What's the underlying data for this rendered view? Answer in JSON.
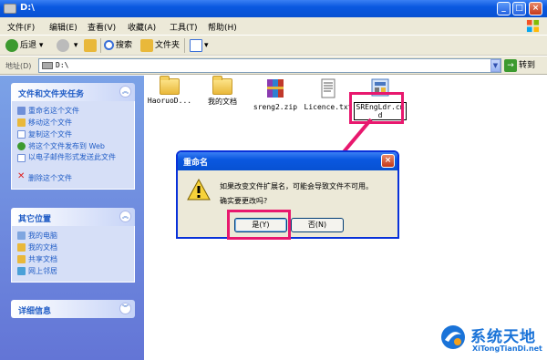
{
  "window": {
    "title": "D:\\"
  },
  "menu": [
    "文件(F)",
    "编辑(E)",
    "查看(V)",
    "收藏(A)",
    "工具(T)",
    "帮助(H)"
  ],
  "toolbar": {
    "back": "后退",
    "search": "搜索",
    "folders": "文件夹"
  },
  "address": {
    "label": "地址(D)",
    "value": "D:\\",
    "go": "转到"
  },
  "tasks_panel": {
    "title": "文件和文件夹任务",
    "items": [
      "重命名这个文件",
      "移动这个文件",
      "复制这个文件",
      "将这个文件发布到 Web",
      "以电子邮件形式发送此文件",
      "删除这个文件"
    ]
  },
  "places_panel": {
    "title": "其它位置",
    "items": [
      "我的电脑",
      "我的文档",
      "共享文档",
      "网上邻居"
    ]
  },
  "details_panel": {
    "title": "详细信息"
  },
  "files": [
    {
      "name": "HaoruoD...",
      "icon": "folder-icon"
    },
    {
      "name": "我的文档",
      "icon": "folder-icon"
    },
    {
      "name": "sreng2.zip",
      "icon": "zip-archive-icon"
    },
    {
      "name": "Licence.txt",
      "icon": "text-file-icon"
    },
    {
      "name": "SREngLdr.cmd",
      "icon": "cmd-file-icon"
    }
  ],
  "dialog": {
    "title": "重命名",
    "message1": "如果改变文件扩展名，可能会导致文件不可用。",
    "message2": "确实要更改吗?",
    "yes": "是(Y)",
    "no": "否(N)"
  },
  "watermark": {
    "title": "系统天地",
    "url": "XiTongTianDi.net"
  },
  "colors": {
    "highlight": "#e8186e",
    "xp_blue": "#0a58e0",
    "link_blue": "#215dc6"
  }
}
